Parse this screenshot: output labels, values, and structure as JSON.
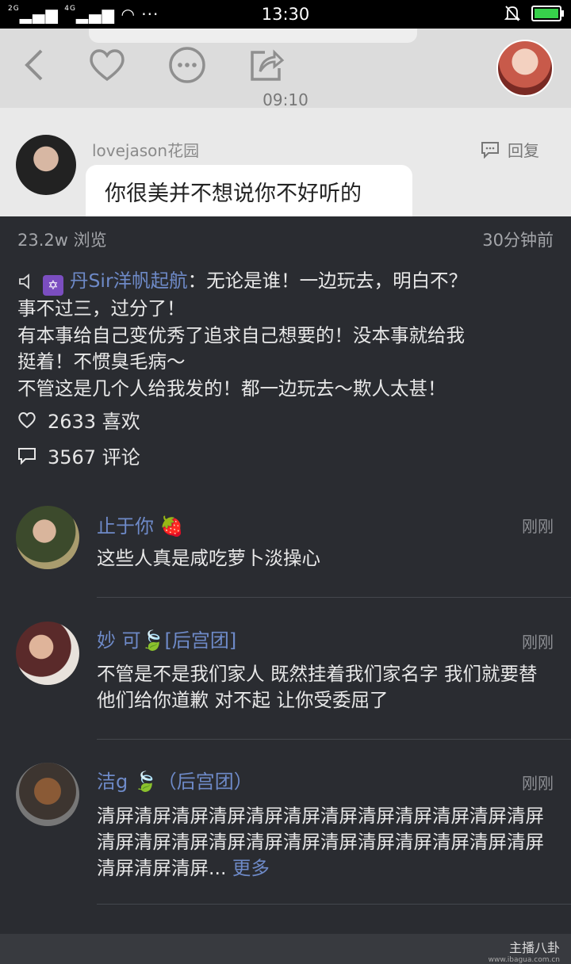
{
  "status_bar": {
    "signal_left": "2G",
    "signal_right": "4G",
    "dots": "···",
    "time": "13:30"
  },
  "chat_header": {
    "timestamp": "09:10"
  },
  "chat_message": {
    "sender": "lovejason花园",
    "reply_label": "回复",
    "text": "你很美并不想说你不好听的"
  },
  "post": {
    "views": "23.2w 浏览",
    "posted_ago": "30分钟前",
    "author": "丹Sir洋帆起航",
    "content_first": "：无论是谁！一边玩去，明白不？",
    "content_lines": [
      "事不过三，过分了！",
      "有本事给自己变优秀了追求自己想要的！没本事就给我",
      "挺着！不惯臭毛病～",
      "不管这是几个人给我发的！都一边玩去～欺人太甚！"
    ],
    "likes": "2633 喜欢",
    "comments_count": "3567 评论"
  },
  "comments": [
    {
      "name": "止于你 🍓",
      "time": "刚刚",
      "text": "这些人真是咸吃萝卜淡操心"
    },
    {
      "name": "妙 可🍃[后宫团]",
      "time": "刚刚",
      "text": "不管是不是我们家人 既然挂着我们家名字 我们就要替他们给你道歉 对不起 让你受委屈了"
    },
    {
      "name": "洁g 🍃（后宫团）",
      "time": "刚刚",
      "text": "清屏清屏清屏清屏清屏清屏清屏清屏清屏清屏清屏清屏清屏清屏清屏清屏清屏清屏清屏清屏清屏清屏清屏清屏清屏清屏清屏...",
      "more": "更多"
    }
  ],
  "watermark": {
    "brand": "主播八卦",
    "url": "www.ibagua.com.cn"
  }
}
